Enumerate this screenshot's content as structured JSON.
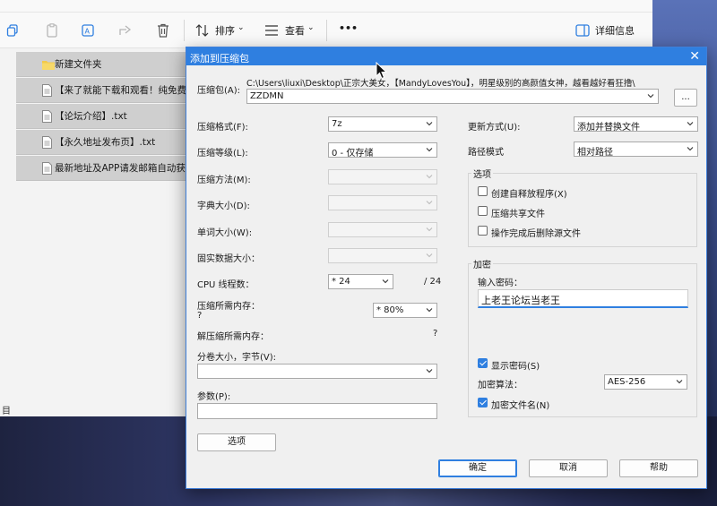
{
  "explorer": {
    "toolbar": {
      "sort_label": "排序",
      "view_label": "查看",
      "more_label": "•••",
      "details_label": "详细信息"
    },
    "files": [
      {
        "name": "新建文件夹",
        "icon": "folder-icon"
      },
      {
        "name": "【来了就能下载和观看！纯免费",
        "icon": "text-file-icon"
      },
      {
        "name": "【论坛介绍】.txt",
        "icon": "text-file-icon"
      },
      {
        "name": "【永久地址发布页】.txt",
        "icon": "text-file-icon"
      },
      {
        "name": "最新地址及APP请发邮箱自动获",
        "icon": "text-file-icon"
      }
    ],
    "status_text": "目"
  },
  "dialog": {
    "title": "添加到压缩包",
    "archive_label": "压缩包(A):",
    "archive_path": "C:\\Users\\liuxi\\Desktop\\正宗大美女，【MandyLovesYou】，明星级别的高颜值女神，越看越好看狂撸\\",
    "archive_name": "ZZDMN",
    "browse_label": "...",
    "format_label": "压缩格式(F):",
    "format_value": "7z",
    "level_label": "压缩等级(L):",
    "level_value": "0 - 仅存储",
    "method_label": "压缩方法(M):",
    "dict_label": "字典大小(D):",
    "word_label": "单词大小(W):",
    "solid_label": "固实数据大小：",
    "cpu_label": "CPU 线程数：",
    "cpu_value": "* 24",
    "cpu_total": "/ 24",
    "mem_comp_label": "压缩所需内存：",
    "mem_comp_value": "?",
    "mem_comp_pct": "* 80%",
    "mem_decomp_label": "解压缩所需内存：",
    "mem_decomp_value": "?",
    "split_label": "分卷大小，字节(V):",
    "split_value": "",
    "params_label": "参数(P):",
    "params_value": "",
    "options_button": "选项",
    "update_label": "更新方式(U):",
    "update_value": "添加并替换文件",
    "path_label": "路径模式",
    "path_value": "相对路径",
    "options_group": {
      "title": "选项",
      "sfx": {
        "label": "创建自释放程序(X)",
        "checked": false
      },
      "shared": {
        "label": "压缩共享文件",
        "checked": false
      },
      "delete": {
        "label": "操作完成后删除源文件",
        "checked": false
      }
    },
    "encrypt_group": {
      "title": "加密",
      "password_label": "输入密码：",
      "password_value": "上老王论坛当老王",
      "show_password": {
        "label": "显示密码(S)",
        "checked": true
      },
      "algo_label": "加密算法：",
      "algo_value": "AES-256",
      "encrypt_names": {
        "label": "加密文件名(N)",
        "checked": true
      }
    },
    "ok_label": "确定",
    "cancel_label": "取消",
    "help_label": "帮助"
  },
  "colors": {
    "accent": "#2f7fe0",
    "selection_row": "#cfcfcf",
    "dialog_bg": "#f0f0f0"
  }
}
